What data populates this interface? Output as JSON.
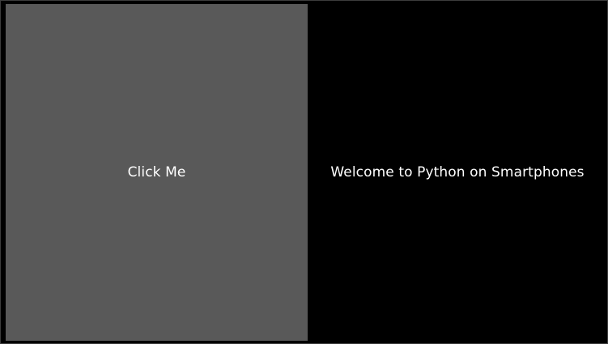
{
  "app": {
    "button_label": "Click Me",
    "welcome_text": "Welcome to Python on Smartphones"
  },
  "colors": {
    "button_background": "#595959",
    "background": "#000000",
    "text": "#ffffff"
  }
}
